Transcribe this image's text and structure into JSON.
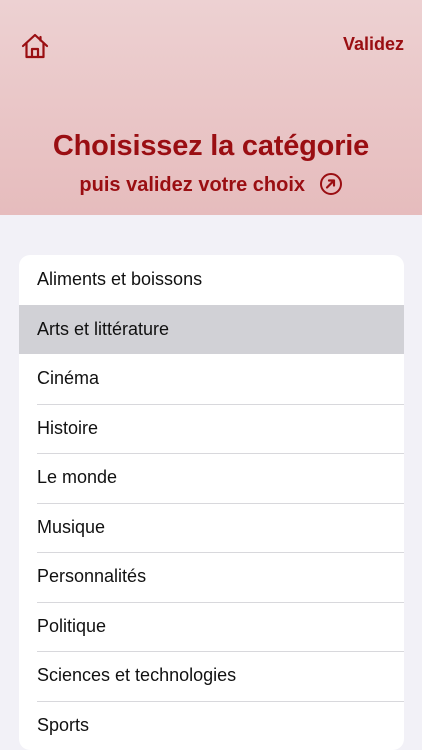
{
  "header": {
    "validate_label": "Validez",
    "title": "Choisissez la catégorie",
    "subtitle": "puis validez votre choix",
    "accent_color": "#9a0e12",
    "background_color": "#e9c6c7"
  },
  "icons": {
    "home": "home-icon",
    "subtitle": "circled-arrow-icon"
  },
  "categories": [
    {
      "label": "Aliments et boissons",
      "selected": false
    },
    {
      "label": "Arts et littérature",
      "selected": true
    },
    {
      "label": "Cinéma",
      "selected": false
    },
    {
      "label": "Histoire",
      "selected": false
    },
    {
      "label": "Le monde",
      "selected": false
    },
    {
      "label": "Musique",
      "selected": false
    },
    {
      "label": "Personnalités",
      "selected": false
    },
    {
      "label": "Politique",
      "selected": false
    },
    {
      "label": "Sciences et technologies",
      "selected": false
    },
    {
      "label": "Sports",
      "selected": false
    }
  ]
}
